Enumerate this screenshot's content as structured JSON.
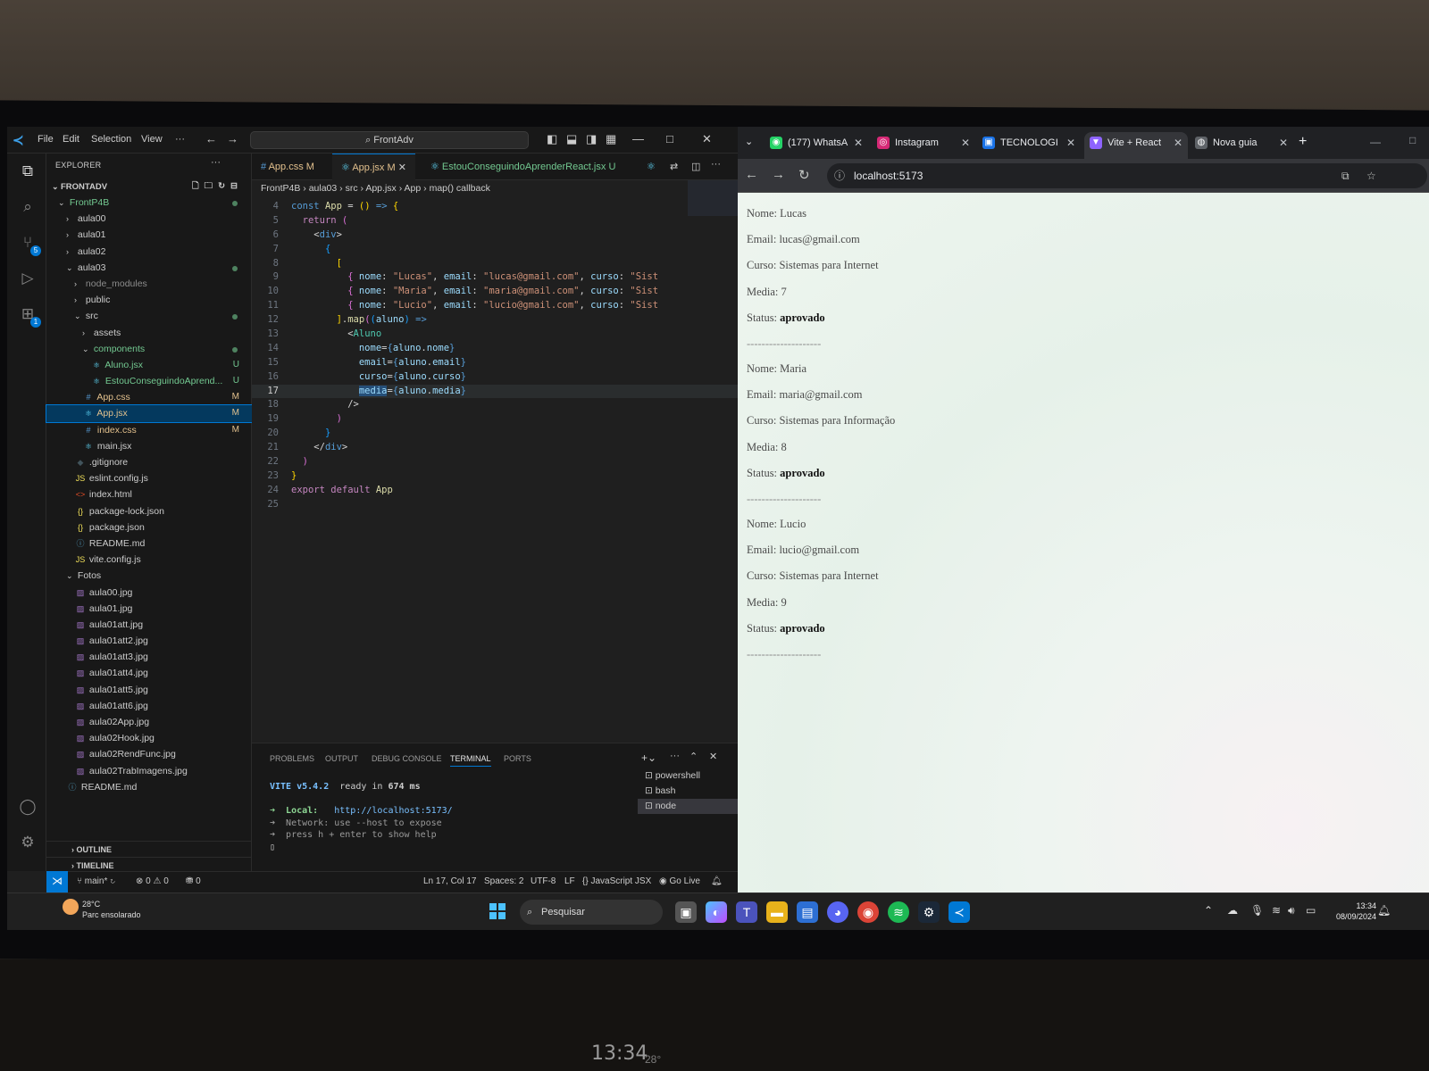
{
  "vscode": {
    "menu": [
      "File",
      "Edit",
      "Selection",
      "View",
      "···"
    ],
    "command_center": "FrontAdv",
    "explorer_title": "EXPLORER",
    "root": "FRONTADV",
    "tree": [
      {
        "label": "FrontP4B",
        "depth": 1,
        "kind": "folder-open",
        "color": "g",
        "dot": true
      },
      {
        "label": "aula00",
        "depth": 2,
        "kind": "folder"
      },
      {
        "label": "aula01",
        "depth": 2,
        "kind": "folder"
      },
      {
        "label": "aula02",
        "depth": 2,
        "kind": "folder"
      },
      {
        "label": "aula03",
        "depth": 2,
        "kind": "folder-open",
        "dot": true
      },
      {
        "label": "node_modules",
        "depth": 3,
        "kind": "folder",
        "dim": true
      },
      {
        "label": "public",
        "depth": 3,
        "kind": "folder"
      },
      {
        "label": "src",
        "depth": 3,
        "kind": "folder-open",
        "dot": true
      },
      {
        "label": "assets",
        "depth": 4,
        "kind": "folder"
      },
      {
        "label": "components",
        "depth": 4,
        "kind": "folder-open",
        "color": "g",
        "dot": true
      },
      {
        "label": "Aluno.jsx",
        "depth": 5,
        "kind": "react",
        "color": "g",
        "status": "U"
      },
      {
        "label": "EstouConseguindoAprend...",
        "depth": 5,
        "kind": "react",
        "color": "g",
        "status": "U"
      },
      {
        "label": "App.css",
        "depth": 4,
        "kind": "css",
        "color": "y",
        "status": "M"
      },
      {
        "label": "App.jsx",
        "depth": 4,
        "kind": "react",
        "color": "y",
        "status": "M",
        "selected": true
      },
      {
        "label": "index.css",
        "depth": 4,
        "kind": "css",
        "color": "y",
        "status": "M"
      },
      {
        "label": "main.jsx",
        "depth": 4,
        "kind": "react"
      },
      {
        "label": ".gitignore",
        "depth": 3,
        "kind": "git"
      },
      {
        "label": "eslint.config.js",
        "depth": 3,
        "kind": "js"
      },
      {
        "label": "index.html",
        "depth": 3,
        "kind": "html"
      },
      {
        "label": "package-lock.json",
        "depth": 3,
        "kind": "json"
      },
      {
        "label": "package.json",
        "depth": 3,
        "kind": "json"
      },
      {
        "label": "README.md",
        "depth": 3,
        "kind": "info"
      },
      {
        "label": "vite.config.js",
        "depth": 3,
        "kind": "js"
      },
      {
        "label": "Fotos",
        "depth": 2,
        "kind": "folder-open"
      },
      {
        "label": "aula00.jpg",
        "depth": 3,
        "kind": "img"
      },
      {
        "label": "aula01.jpg",
        "depth": 3,
        "kind": "img"
      },
      {
        "label": "aula01att.jpg",
        "depth": 3,
        "kind": "img"
      },
      {
        "label": "aula01att2.jpg",
        "depth": 3,
        "kind": "img"
      },
      {
        "label": "aula01att3.jpg",
        "depth": 3,
        "kind": "img"
      },
      {
        "label": "aula01att4.jpg",
        "depth": 3,
        "kind": "img"
      },
      {
        "label": "aula01att5.jpg",
        "depth": 3,
        "kind": "img"
      },
      {
        "label": "aula01att6.jpg",
        "depth": 3,
        "kind": "img"
      },
      {
        "label": "aula02App.jpg",
        "depth": 3,
        "kind": "img"
      },
      {
        "label": "aula02Hook.jpg",
        "depth": 3,
        "kind": "img"
      },
      {
        "label": "aula02RendFunc.jpg",
        "depth": 3,
        "kind": "img"
      },
      {
        "label": "aula02TrabImagens.jpg",
        "depth": 3,
        "kind": "img"
      },
      {
        "label": "README.md",
        "depth": 2,
        "kind": "info"
      }
    ],
    "outline": "OUTLINE",
    "timeline": "TIMELINE",
    "tabs": [
      {
        "label": "App.css",
        "status": "M",
        "icon": "#"
      },
      {
        "label": "App.jsx",
        "status": "M",
        "icon": "⚛",
        "active": true
      },
      {
        "label": "EstouConseguindoAprenderReact.jsx",
        "status": "U",
        "icon": "⚛"
      }
    ],
    "breadcrumb": [
      "FrontP4B",
      "aula03",
      "src",
      "App.jsx",
      "App",
      "map() callback"
    ],
    "code": [
      {
        "n": "4",
        "h": "<span class='kw'>const</span> <span class='fn'>App</span> <span class='pl'>=</span> <span class='br1'>()</span> <span class='kw'>=&gt;</span> <span class='br1'>{</span>"
      },
      {
        "n": "5",
        "h": "  <span class='kw2'>return</span> <span class='br2'>(</span>"
      },
      {
        "n": "6",
        "h": "    <span class='pl'>&lt;</span><span class='kw'>div</span><span class='pl'>&gt;</span>"
      },
      {
        "n": "7",
        "h": "      <span class='br3'>{</span>"
      },
      {
        "n": "8",
        "h": "        <span class='br1'>[</span>"
      },
      {
        "n": "9",
        "h": "          <span class='br2'>{</span> <span class='prop'>nome</span><span class='pl'>:</span> <span class='str'>\"Lucas\"</span><span class='pl'>,</span> <span class='prop'>email</span><span class='pl'>:</span> <span class='str'>\"lucas@gmail.com\"</span><span class='pl'>,</span> <span class='prop'>curso</span><span class='pl'>:</span> <span class='str'>\"Sist</span>"
      },
      {
        "n": "10",
        "h": "          <span class='br2'>{</span> <span class='prop'>nome</span><span class='pl'>:</span> <span class='str'>\"Maria\"</span><span class='pl'>,</span> <span class='prop'>email</span><span class='pl'>:</span> <span class='str'>\"maria@gmail.com\"</span><span class='pl'>,</span> <span class='prop'>curso</span><span class='pl'>:</span> <span class='str'>\"Sist</span>"
      },
      {
        "n": "11",
        "h": "          <span class='br2'>{</span> <span class='prop'>nome</span><span class='pl'>:</span> <span class='str'>\"Lucio\"</span><span class='pl'>,</span> <span class='prop'>email</span><span class='pl'>:</span> <span class='str'>\"lucio@gmail.com\"</span><span class='pl'>,</span> <span class='prop'>curso</span><span class='pl'>:</span> <span class='str'>\"Sist</span>"
      },
      {
        "n": "12",
        "h": "        <span class='br1'>]</span><span class='pl'>.</span><span class='fn'>map</span><span class='br2'>(</span><span class='br3'>(</span><span class='prop'>aluno</span><span class='br3'>)</span> <span class='kw'>=&gt;</span>"
      },
      {
        "n": "13",
        "h": "          <span class='pl'>&lt;</span><span class='tag'>Aluno</span>"
      },
      {
        "n": "14",
        "h": "            <span class='prop'>nome</span><span class='pl'>=</span><span class='kw'>{</span><span class='prop'>aluno</span><span class='pl'>.</span><span class='prop'>nome</span><span class='kw'>}</span>"
      },
      {
        "n": "15",
        "h": "            <span class='prop'>email</span><span class='pl'>=</span><span class='kw'>{</span><span class='prop'>aluno</span><span class='pl'>.</span><span class='prop'>email</span><span class='kw'>}</span>"
      },
      {
        "n": "16",
        "h": "            <span class='prop'>curso</span><span class='pl'>=</span><span class='kw'>{</span><span class='prop'>aluno</span><span class='pl'>.</span><span class='prop'>curso</span><span class='kw'>}</span>"
      },
      {
        "n": "17",
        "h": "            <span class='prop' style='background:#264f78'>media</span><span class='pl'>=</span><span class='kw'>{</span><span class='prop'>aluno</span><span class='pl'>.</span><span class='prop'>media</span><span class='kw'>}</span>",
        "cur": true
      },
      {
        "n": "18",
        "h": "          <span class='pl'>/&gt;</span>"
      },
      {
        "n": "19",
        "h": "        <span class='br2'>)</span>"
      },
      {
        "n": "20",
        "h": "      <span class='br3'>}</span>"
      },
      {
        "n": "21",
        "h": "    <span class='pl'>&lt;/</span><span class='kw'>div</span><span class='pl'>&gt;</span>"
      },
      {
        "n": "22",
        "h": "  <span class='br2'>)</span>"
      },
      {
        "n": "23",
        "h": "<span class='br1'>}</span>"
      },
      {
        "n": "24",
        "h": "<span class='kw2'>export</span> <span class='kw2'>default</span> <span class='fn'>App</span>"
      },
      {
        "n": "25",
        "h": ""
      }
    ],
    "panel_tabs": [
      "PROBLEMS",
      "OUTPUT",
      "DEBUG CONSOLE",
      "TERMINAL",
      "PORTS"
    ],
    "terminal": {
      "line1_a": "VITE v5.4.2",
      "line1_b": "  ready in ",
      "line1_c": "674 ms",
      "local_label": "➜  Local:   ",
      "local_url": "http://localhost:5173/",
      "network": "➜  Network: use --host to expose",
      "help": "➜  press h + enter to show help"
    },
    "terminals": [
      "powershell",
      "bash",
      "node"
    ],
    "status": {
      "branch": "main*",
      "problems": "⊗ 0 ⚠ 0",
      "ports": "⛃ 0",
      "position": "Ln 17, Col 17",
      "spaces": "Spaces: 2",
      "encoding": "UTF-8",
      "eol": "LF",
      "language": "{} JavaScript JSX",
      "golive": "Go Live"
    }
  },
  "browser": {
    "tabs": [
      {
        "label": "(177) WhatsA",
        "color": "#25d366",
        "icon": "◉"
      },
      {
        "label": "Instagram",
        "color": "#d62976",
        "icon": "◎"
      },
      {
        "label": "TECNOLOGI",
        "color": "#1a73e8",
        "icon": "▣"
      },
      {
        "label": "Vite + React",
        "color": "#8e63ff",
        "icon": "▼",
        "active": true
      },
      {
        "label": "Nova guia",
        "color": "#5f6368",
        "icon": "◍"
      }
    ],
    "url": "localhost:5173",
    "students": [
      {
        "nome_label": "Nome: ",
        "nome": "Lucas",
        "email_label": "Email: ",
        "email": "lucas@gmail.com",
        "curso_label": "Curso: ",
        "curso": "Sistemas para Internet",
        "media_label": "Media: ",
        "media": "7",
        "status_label": "Status: ",
        "status": "aprovado",
        "sep": "--------------------"
      },
      {
        "nome_label": "Nome: ",
        "nome": "Maria",
        "email_label": "Email: ",
        "email": "maria@gmail.com",
        "curso_label": "Curso: ",
        "curso": "Sistemas para Informação",
        "media_label": "Media: ",
        "media": "8",
        "status_label": "Status: ",
        "status": "aprovado",
        "sep": "--------------------"
      },
      {
        "nome_label": "Nome: ",
        "nome": "Lucio",
        "email_label": "Email: ",
        "email": "lucio@gmail.com",
        "curso_label": "Curso: ",
        "curso": "Sistemas para Internet",
        "media_label": "Media: ",
        "media": "9",
        "status_label": "Status: ",
        "status": "aprovado",
        "sep": "--------------------"
      }
    ]
  },
  "taskbar": {
    "weather_temp": "28°C",
    "weather_desc": "Parc ensolarado",
    "search": "Pesquisar",
    "time": "13:34",
    "date": "08/09/2024"
  },
  "desk": {
    "clock": "13:34",
    "temp": "28°"
  }
}
